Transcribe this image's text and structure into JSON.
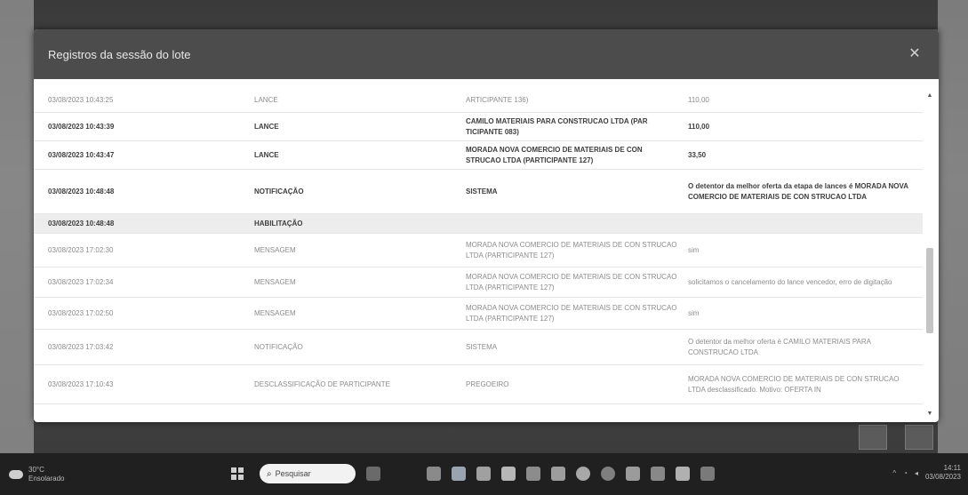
{
  "modal": {
    "title": "Registros da sessão do lote",
    "close_label": "✕"
  },
  "rows": [
    {
      "date": "03/08/2023 10:43:25",
      "type": "LANCE",
      "participant": "ARTICIPANTE 136)",
      "message": "110,00",
      "dark": false,
      "shaded": false
    },
    {
      "date": "03/08/2023 10:43:39",
      "type": "LANCE",
      "participant": "CAMILO MATERIAIS PARA CONSTRUCAO LTDA (PAR TICIPANTE 083)",
      "message": "110,00",
      "dark": true,
      "shaded": false
    },
    {
      "date": "03/08/2023 10:43:47",
      "type": "LANCE",
      "participant": "MORADA NOVA COMERCIO DE MATERIAIS DE CON STRUCAO LTDA (PARTICIPANTE 127)",
      "message": "33,50",
      "dark": true,
      "shaded": false
    },
    {
      "date": "03/08/2023 10:48:48",
      "type": "NOTIFICAÇÃO",
      "participant": "SISTEMA",
      "message": "O detentor da melhor oferta da etapa de lances é MORADA NOVA COMERCIO DE MATERIAIS DE CON STRUCAO LTDA",
      "dark": true,
      "shaded": false
    },
    {
      "date": "03/08/2023 10:48:48",
      "type": "HABILITAÇÃO",
      "participant": "",
      "message": "",
      "dark": true,
      "shaded": true
    },
    {
      "date": "03/08/2023 17:02:30",
      "type": "MENSAGEM",
      "participant": "MORADA NOVA COMERCIO DE MATERIAIS DE CON STRUCAO LTDA (PARTICIPANTE 127)",
      "message": "sim",
      "dark": false,
      "shaded": false
    },
    {
      "date": "03/08/2023 17:02:34",
      "type": "MENSAGEM",
      "participant": "MORADA NOVA COMERCIO DE MATERIAIS DE CON STRUCAO LTDA (PARTICIPANTE 127)",
      "message": "solicitamos o cancelamento do lance vencedor, erro de digitação",
      "dark": false,
      "shaded": false
    },
    {
      "date": "03/08/2023 17:02:50",
      "type": "MENSAGEM",
      "participant": "MORADA NOVA COMERCIO DE MATERIAIS DE CON STRUCAO LTDA (PARTICIPANTE 127)",
      "message": "sim",
      "dark": false,
      "shaded": false
    },
    {
      "date": "03/08/2023 17:03:42",
      "type": "NOTIFICAÇÃO",
      "participant": "SISTEMA",
      "message": "O detentor da melhor oferta é CAMILO MATERIAIS PARA CONSTRUCAO LTDA",
      "dark": false,
      "shaded": false
    },
    {
      "date": "03/08/2023 17:10:43",
      "type": "DESCLASSIFICAÇÃO DE PARTICIPANTE",
      "participant": "PREGOEIRO",
      "message": "MORADA NOVA COMERCIO DE MATERIAIS DE CON STRUCAO LTDA desclassificado. Motivo: OFERTA IN",
      "dark": false,
      "shaded": false
    }
  ],
  "taskbar": {
    "weather_temp": "30°C",
    "weather_desc": "Ensolarado",
    "search_placeholder": "Pesquisar",
    "clock_time": "14:11",
    "clock_date": "03/08/2023"
  },
  "colors": {
    "header_bg": "#4c4c4c",
    "taskbar_bg": "#202020"
  }
}
